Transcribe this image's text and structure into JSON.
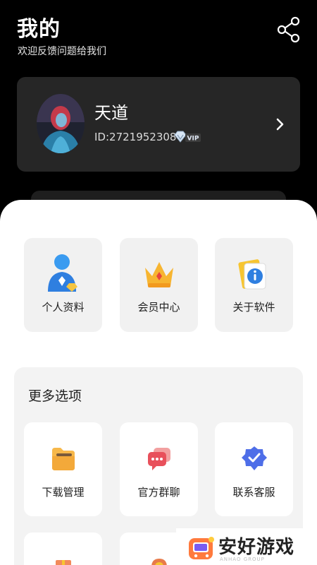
{
  "header": {
    "title": "我的",
    "subtitle": "欢迎反馈问题给我们",
    "share_icon": "share-icon"
  },
  "profile": {
    "name": "天道",
    "id_text": "ID:2721952308",
    "vip_badge": "VIP",
    "chevron_icon": "chevron-right-icon"
  },
  "top_tiles": [
    {
      "label": "个人资料",
      "icon": "user-profile-icon"
    },
    {
      "label": "会员中心",
      "icon": "crown-icon"
    },
    {
      "label": "关于软件",
      "icon": "info-icon"
    }
  ],
  "more": {
    "title": "更多选项",
    "tiles": [
      {
        "label": "下载管理",
        "icon": "folder-icon"
      },
      {
        "label": "官方群聊",
        "icon": "chat-icon"
      },
      {
        "label": "联系客服",
        "icon": "service-badge-icon"
      }
    ]
  },
  "watermark": {
    "text": "安好游戏",
    "sub": "ANHAO GROUP"
  },
  "colors": {
    "background": "#000000",
    "card": "#262626",
    "sheet": "#ffffff",
    "tile": "#f1f1f1",
    "accent_blue": "#2f8cf0",
    "accent_orange": "#f5a623"
  }
}
